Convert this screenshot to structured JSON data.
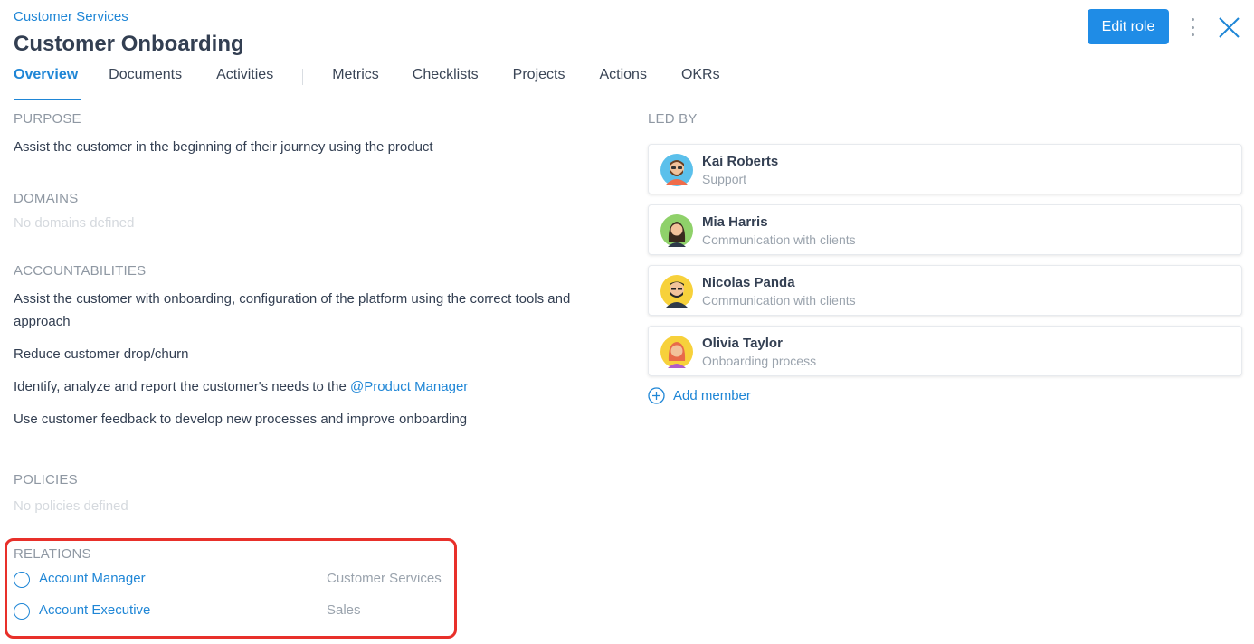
{
  "header": {
    "breadcrumb": "Customer Services",
    "title": "Customer Onboarding",
    "edit_label": "Edit role",
    "more_icon": "kebab-vertical-icon",
    "close_icon": "close-icon"
  },
  "tabs": [
    "Overview",
    "Documents",
    "Activities",
    "Metrics",
    "Checklists",
    "Projects",
    "Actions",
    "OKRs"
  ],
  "active_tab": "Overview",
  "purpose": {
    "label": "PURPOSE",
    "text": "Assist the customer in the beginning of their journey using the product"
  },
  "domains": {
    "label": "DOMAINS",
    "empty": "No domains defined"
  },
  "accountabilities": {
    "label": "ACCOUNTABILITIES",
    "items": [
      "Assist the customer with onboarding, configuration of the platform using the correct tools and approach",
      "Reduce customer drop/churn",
      "Identify, analyze and report the customer's needs to the",
      "Use customer feedback to develop new processes and improve onboarding"
    ],
    "mention": "@Product Manager"
  },
  "policies": {
    "label": "POLICIES",
    "empty": "No policies defined"
  },
  "relations": {
    "label": "RELATIONS",
    "items": [
      {
        "name": "Account Manager",
        "circle": "Customer Services"
      },
      {
        "name": "Account Executive",
        "circle": "Sales"
      }
    ]
  },
  "led_by": {
    "label": "LED BY",
    "members": [
      {
        "name": "Kai Roberts",
        "role": "Support"
      },
      {
        "name": "Mia Harris",
        "role": "Communication with clients"
      },
      {
        "name": "Nicolas Panda",
        "role": "Communication with clients"
      },
      {
        "name": "Olivia Taylor",
        "role": "Onboarding process"
      }
    ],
    "add_label": "Add member"
  },
  "colors": {
    "accent": "#1f86d6",
    "button": "#1f8ce6",
    "highlight_border": "#e8302a"
  }
}
